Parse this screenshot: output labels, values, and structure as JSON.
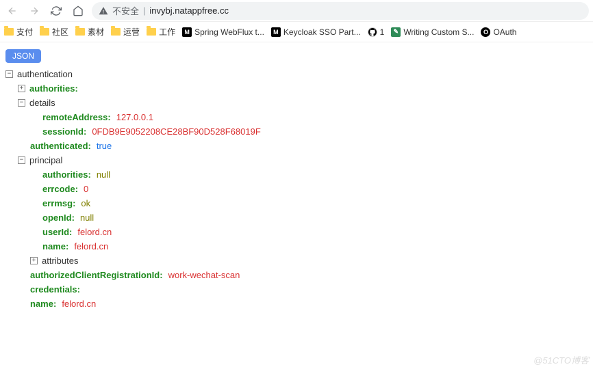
{
  "toolbar": {
    "security_label": "不安全",
    "url": "invybj.natappfree.cc"
  },
  "bookmarks": {
    "b0": "支付",
    "b1": "社区",
    "b2": "素材",
    "b3": "运营",
    "b4": "工作",
    "b5": "Spring WebFlux t...",
    "b6": "Keycloak SSO Part...",
    "b7_badge": "1",
    "b8": "Writing Custom S...",
    "b9": "OAuth"
  },
  "json_badge": "JSON",
  "tree": {
    "root": "authentication",
    "authorities_k": "authorities",
    "details_k": "details",
    "remoteAddress_k": "remoteAddress",
    "remoteAddress_v": "127.0.0.1",
    "sessionId_k": "sessionId",
    "sessionId_v": "0FDB9E9052208CE28BF90D528F68019F",
    "authenticated_k": "authenticated",
    "authenticated_v": "true",
    "principal_k": "principal",
    "p_authorities_k": "authorities",
    "p_authorities_v": "null",
    "errcode_k": "errcode",
    "errcode_v": "0",
    "errmsg_k": "errmsg",
    "errmsg_v": "ok",
    "openId_k": "openId",
    "openId_v": "null",
    "userId_k": "userId",
    "userId_v": "felord.cn",
    "pname_k": "name",
    "pname_v": "felord.cn",
    "attributes_k": "attributes",
    "acri_k": "authorizedClientRegistrationId",
    "acri_v": "work-wechat-scan",
    "credentials_k": "credentials",
    "name_k": "name",
    "name_v": "felord.cn"
  },
  "watermark": "@51CTO博客"
}
